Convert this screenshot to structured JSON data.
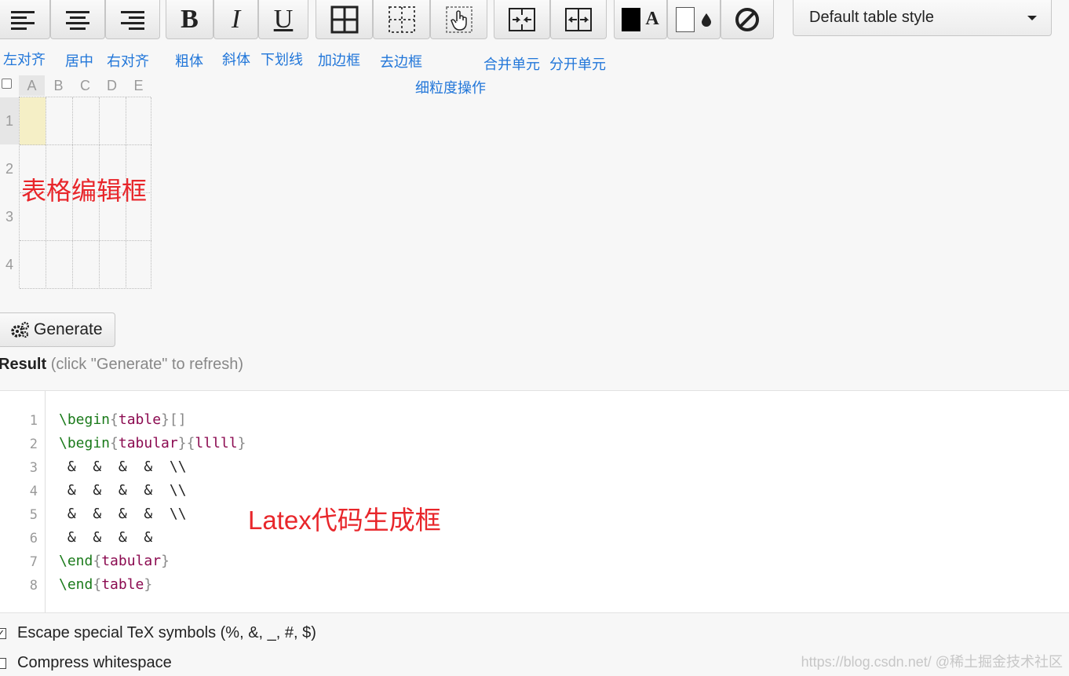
{
  "toolbar": {
    "align_left_label": "左对齐",
    "align_center_label": "居中",
    "align_right_label": "右对齐",
    "bold_glyph": "B",
    "bold_label": "粗体",
    "italic_glyph": "I",
    "italic_label": "斜体",
    "underline_glyph": "U",
    "underline_label": "下划线",
    "add_border_label": "加边框",
    "remove_border_label": "去边框",
    "fine_grain_label": "细粒度操作",
    "merge_label": "合并单元",
    "split_label": "分开单元",
    "text_color_glyph": "A",
    "bg_color_glyph": "●",
    "table_style": "Default table style"
  },
  "sheet": {
    "columns": [
      "A",
      "B",
      "C",
      "D",
      "E"
    ],
    "rows": [
      "1",
      "2",
      "3",
      "4"
    ]
  },
  "generate_label": "Generate",
  "result": {
    "title": "Result",
    "hint": "(click \"Generate\" to refresh)"
  },
  "code": {
    "line_numbers": [
      "1",
      "2",
      "3",
      "4",
      "5",
      "6",
      "7",
      "8"
    ],
    "amp_row": " &  &  &  &  \\\\",
    "amp_last": " &  &  &  &",
    "begin": "\\begin",
    "end": "\\end",
    "table": "table",
    "tabular": "tabular",
    "colspec": "lllll"
  },
  "options": {
    "escape_label": "Escape special TeX symbols (%, &, _, #, $)",
    "escape_checked": true,
    "compress_label": "Compress whitespace",
    "compress_checked": false
  },
  "annotations": {
    "table_editor": "表格编辑框",
    "latex_output": "Latex代码生成框"
  },
  "watermark": "https://blog.csdn.net/ @稀土掘金技术社区",
  "colors": {
    "label_blue": "#2176d9",
    "annotation_red": "#e8262b",
    "selected_cell": "#f5efc6",
    "keyword_green": "#1a7a1a",
    "env_purple": "#8b0a50"
  }
}
